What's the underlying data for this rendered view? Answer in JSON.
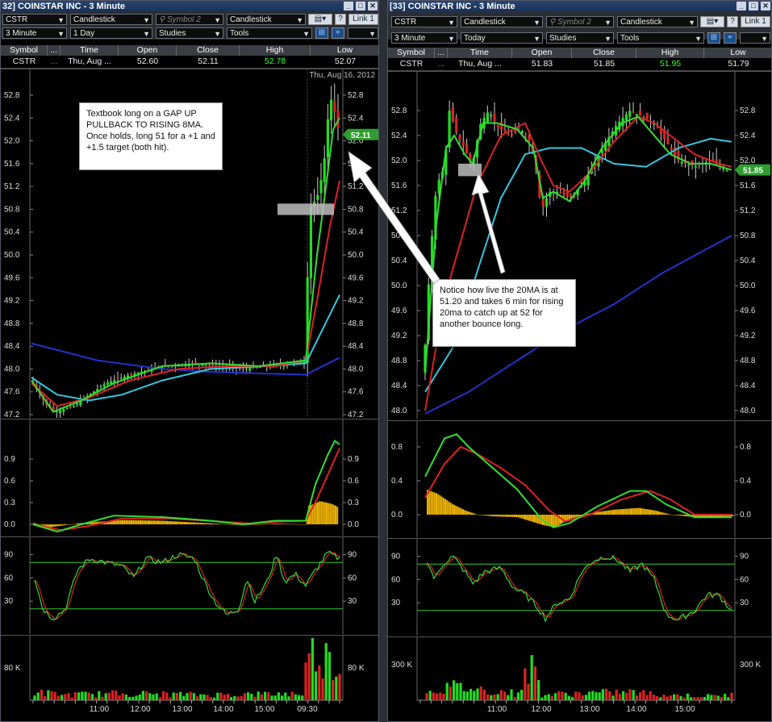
{
  "left": {
    "title": "32] COINSTAR INC - 3 Minute",
    "toolbar": {
      "symbol": "CSTR",
      "chart_type": "Candlestick",
      "symbol2_placeholder": "Symbol 2",
      "chart_type2": "Candlestick",
      "link": "Link 1",
      "help": "?",
      "interval": "3 Minute",
      "range": "1 Day",
      "studies": "Studies",
      "tools": "Tools"
    },
    "quote": {
      "headers": [
        "Symbol",
        "...",
        "Time",
        "Open",
        "Close",
        "High",
        "Low"
      ],
      "values": [
        "CSTR",
        "...",
        "Thu, Aug ...",
        "52.60",
        "52.11",
        "52.78",
        "52.07"
      ]
    },
    "date_label": "Thu, Aug 16, 2012",
    "last_price_badge": "52.11",
    "note": "Textbook long on a GAP UP PULLBACK TO RISING 8MA. Once holds, long 51 for a +1 and +1.5 target (both hit).",
    "x_ticks": [
      "11:00",
      "12:00",
      "13:00",
      "14:00",
      "15:00",
      "09:30"
    ]
  },
  "right": {
    "title": "[33] COINSTAR INC - 3 Minute",
    "toolbar": {
      "symbol": "CSTR",
      "chart_type": "Candlestick",
      "symbol2_placeholder": "Symbol 2",
      "chart_type2": "Candlestick",
      "link": "Link 1",
      "help": "?",
      "interval": "3 Minute",
      "range": "Today",
      "studies": "Studies",
      "tools": "Tools"
    },
    "quote": {
      "headers": [
        "Symbol",
        "...",
        "Time",
        "Open",
        "Close",
        "High",
        "Low"
      ],
      "values": [
        "CSTR",
        "...",
        "Thu, Aug ...",
        "51.83",
        "51.85",
        "51.95",
        "51.79"
      ]
    },
    "last_price_badge": "51.85",
    "note": "Notice how live the 20MA is at 51.20 and takes 6 min for rising 20ma to catch up at 52 for another bounce long.",
    "x_ticks": [
      "11:00",
      "12:00",
      "13:00",
      "14:00",
      "15:00"
    ]
  },
  "colors": {
    "up": "#22dd22",
    "down": "#dd2222",
    "ma_fast": "#33dd33",
    "ma_mid": "#dd2222",
    "ma_cyan": "#33c8e0",
    "ma_slow": "#2233cc",
    "macd_hist": "#f0b400",
    "badge": "#2f9e2f"
  },
  "chart_data": [
    {
      "type": "candlestick",
      "window": "left",
      "y_ticks": [
        "52.8",
        "52.4",
        "52.0",
        "51.6",
        "51.2",
        "50.8",
        "50.4",
        "50.0",
        "49.6",
        "49.2",
        "48.8",
        "48.4",
        "48.0",
        "47.6",
        "47.2"
      ],
      "ylim": [
        47.0,
        53.0
      ],
      "x": [
        "11:00",
        "12:00",
        "13:00",
        "14:00",
        "15:00",
        "09:30"
      ],
      "approx_close": [
        47.8,
        47.3,
        47.6,
        47.8,
        48.0,
        48.1,
        48.0,
        48.0,
        48.1,
        48.1,
        50.9,
        52.8,
        52.11
      ],
      "close": 52.11,
      "open": 52.6,
      "high": 52.78,
      "low": 52.07,
      "shaded_zone": [
        50.7,
        50.9
      ]
    },
    {
      "type": "line",
      "window": "left",
      "panel": "macd",
      "y_ticks": [
        "0.9",
        "0.6",
        "0.3",
        "0.0"
      ],
      "ylim": [
        -0.1,
        1.2
      ]
    },
    {
      "type": "line",
      "window": "left",
      "panel": "stochastic",
      "y_ticks": [
        "90",
        "60",
        "30"
      ],
      "ylim": [
        0,
        100
      ],
      "levels": [
        80,
        20
      ]
    },
    {
      "type": "bar",
      "window": "left",
      "panel": "volume",
      "y_ticks": [
        "80 K"
      ]
    },
    {
      "type": "candlestick",
      "window": "right",
      "y_ticks": [
        "52.8",
        "52.4",
        "52.0",
        "51.6",
        "51.2",
        "50.8",
        "50.4",
        "50.0",
        "49.6",
        "49.2",
        "48.8",
        "48.4",
        "48.0"
      ],
      "ylim": [
        47.9,
        53.2
      ],
      "x": [
        "11:00",
        "12:00",
        "13:00",
        "14:00",
        "15:00"
      ],
      "approx_close": [
        48.6,
        52.8,
        52.0,
        52.8,
        52.4,
        51.2,
        51.4,
        52.4,
        52.8,
        52.4,
        52.0,
        51.85
      ],
      "close": 51.85,
      "open": 51.83,
      "high": 51.95,
      "low": 51.79,
      "shaded_zone": [
        51.75,
        51.95
      ]
    },
    {
      "type": "line",
      "window": "right",
      "panel": "macd",
      "y_ticks": [
        "0.8",
        "0.4",
        "0.0"
      ],
      "ylim": [
        -0.2,
        1.0
      ]
    },
    {
      "type": "line",
      "window": "right",
      "panel": "stochastic",
      "y_ticks": [
        "90",
        "60",
        "30"
      ],
      "ylim": [
        0,
        100
      ],
      "levels": [
        80,
        20
      ]
    },
    {
      "type": "bar",
      "window": "right",
      "panel": "volume",
      "y_ticks": [
        "300 K"
      ]
    }
  ]
}
